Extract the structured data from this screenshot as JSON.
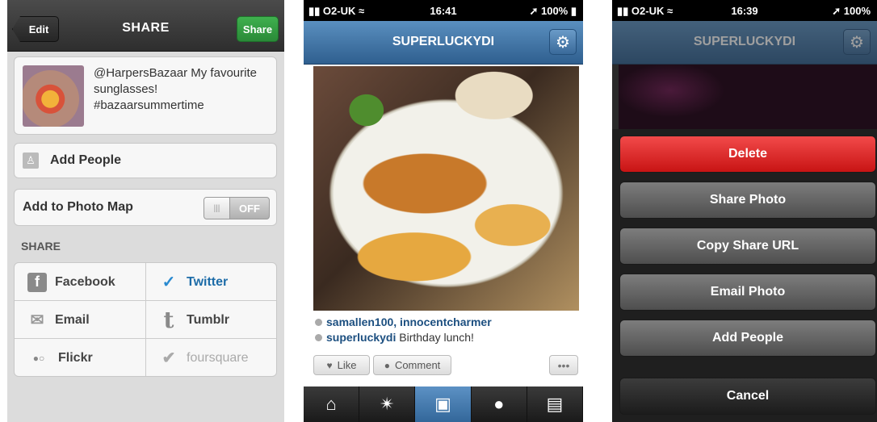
{
  "share_screen": {
    "edit_label": "Edit",
    "title": "SHARE",
    "share_label": "Share",
    "caption": "@HarpersBazaar My favourite sunglasses! #bazaarsummertime",
    "add_people": "Add People",
    "photo_map_label": "Add to Photo Map",
    "photo_map_state": "OFF",
    "section_header": "SHARE",
    "services": {
      "facebook": "Facebook",
      "twitter": "Twitter",
      "email": "Email",
      "tumblr": "Tumblr",
      "flickr": "Flickr",
      "foursquare": "foursquare"
    }
  },
  "photo_screen": {
    "carrier": "O2-UK",
    "time": "16:41",
    "battery": "100%",
    "title": "SUPERLUCKYDI",
    "likes": "samallen100, innocentcharmer",
    "caption_user": "superluckydi",
    "caption_text": "Birthday lunch!",
    "like_label": "Like",
    "comment_label": "Comment",
    "more_label": "•••"
  },
  "menu_screen": {
    "carrier": "O2-UK",
    "time": "16:39",
    "battery": "100%",
    "title": "SUPERLUCKYDI",
    "buttons": {
      "delete": "Delete",
      "share_photo": "Share Photo",
      "copy_url": "Copy Share URL",
      "email_photo": "Email Photo",
      "add_people": "Add People",
      "cancel": "Cancel"
    }
  },
  "colors": {
    "share_green": "#2e9a3e",
    "nav_blue": "#3f6f9f",
    "delete_red": "#d92020",
    "twitter_blue": "#1d6ca8"
  }
}
